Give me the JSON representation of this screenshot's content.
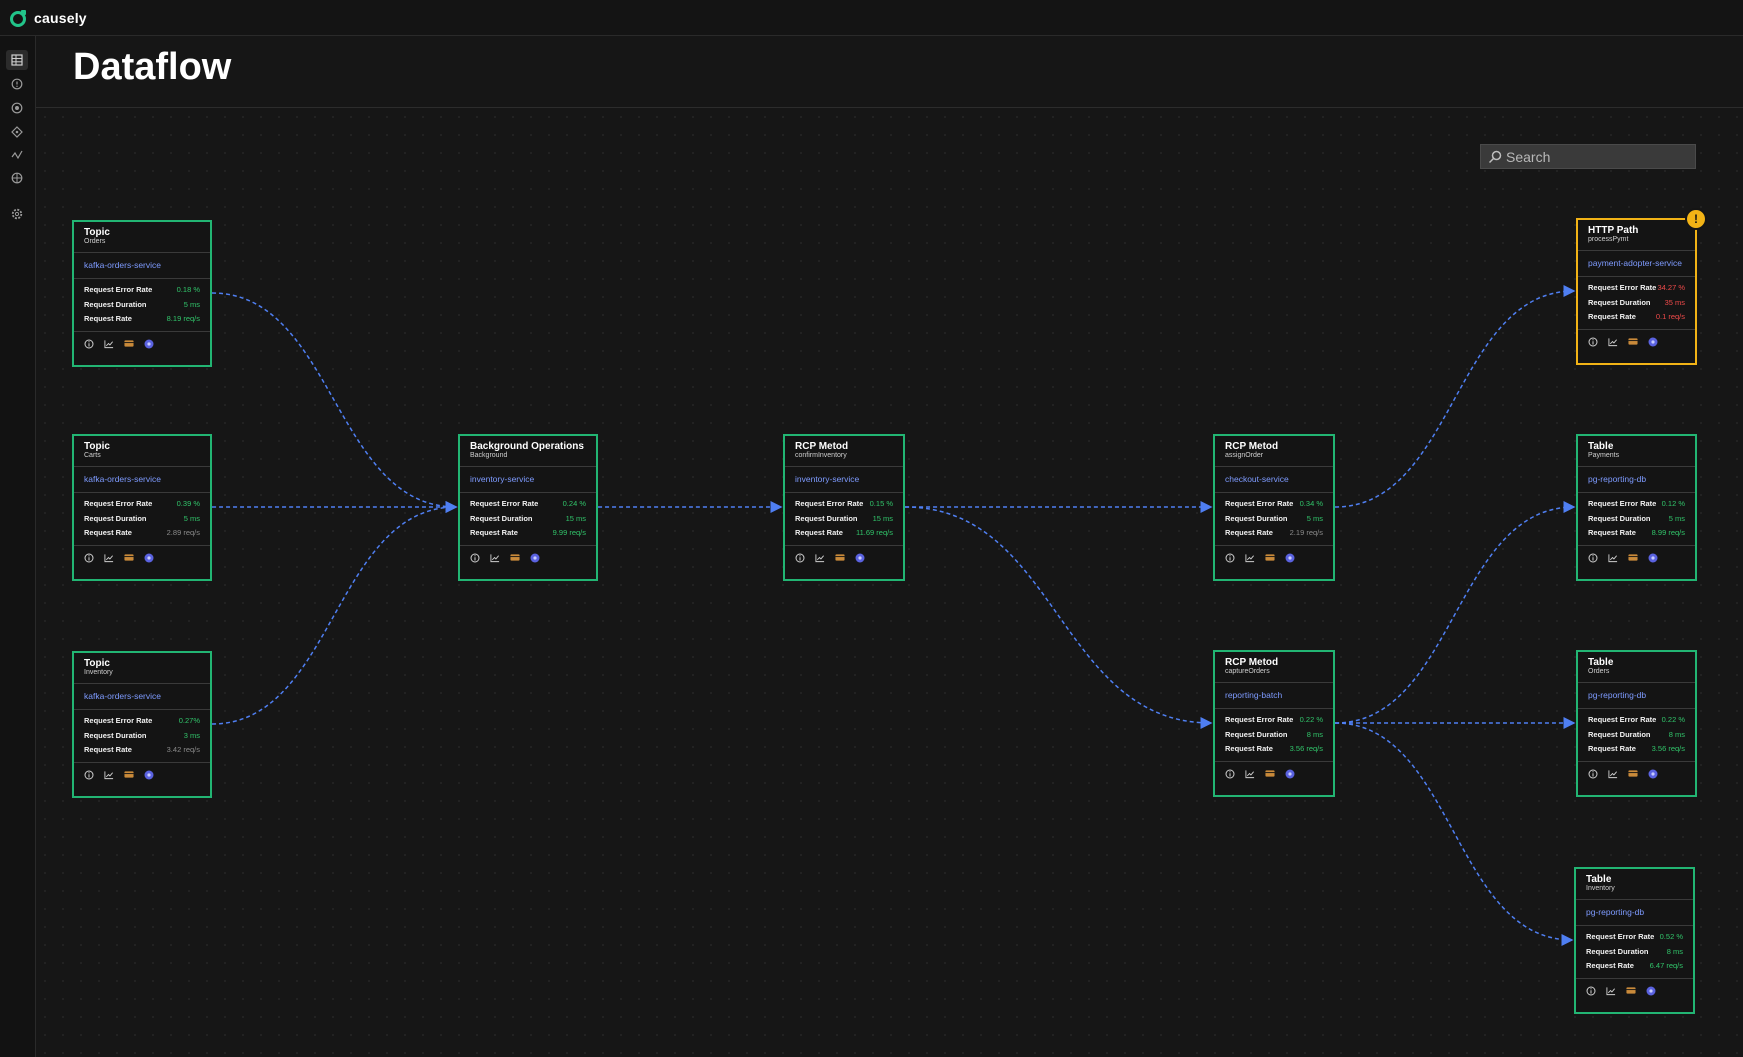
{
  "app": {
    "name": "causely"
  },
  "page": {
    "title": "Dataflow"
  },
  "sidebar": {
    "items": [
      {
        "icon": "table-icon",
        "active": true
      },
      {
        "icon": "alert-circle-icon"
      },
      {
        "icon": "target-icon"
      },
      {
        "icon": "diamond-icon"
      },
      {
        "icon": "activity-icon"
      },
      {
        "icon": "network-icon"
      },
      {
        "icon": "gear-icon"
      }
    ]
  },
  "search": {
    "placeholder": "Search"
  },
  "colors": {
    "healthy": "#22b573",
    "warning": "#f2b316",
    "service": "#7e9bff",
    "edge": "#4f7ff2",
    "good_value": "#31c46a",
    "bad_value": "#f04a4a"
  },
  "metric_labels": {
    "error_rate": "Request Error Rate",
    "duration": "Request Duration",
    "rate": "Request Rate"
  },
  "nodes": [
    {
      "id": "topic-orders",
      "type": "Topic",
      "sub": "Orders",
      "service": "kafka-orders-service",
      "error_rate": "0.18 %",
      "duration": "5 ms",
      "rate": "8.19 req/s",
      "status": "healthy"
    },
    {
      "id": "topic-carts",
      "type": "Topic",
      "sub": "Carts",
      "service": "kafka-orders-service",
      "error_rate": "0.39 %",
      "duration": "5 ms",
      "rate": "2.89 req/s",
      "status": "healthy"
    },
    {
      "id": "topic-inventory",
      "type": "Topic",
      "sub": "Inventory",
      "service": "kafka-orders-service",
      "error_rate": "0.27%",
      "duration": "3 ms",
      "rate": "3.42 req/s",
      "status": "healthy"
    },
    {
      "id": "background-ops",
      "type": "Background Operations",
      "sub": "Background",
      "service": "inventory-service",
      "error_rate": "0.24 %",
      "duration": "15 ms",
      "rate": "9.99 req/s",
      "status": "healthy"
    },
    {
      "id": "rcp-confirm",
      "type": "RCP Metod",
      "sub": "confirmInventory",
      "service": "inventory-service",
      "error_rate": "0.15 %",
      "duration": "15 ms",
      "rate": "11.69 req/s",
      "status": "healthy"
    },
    {
      "id": "rcp-assign",
      "type": "RCP Metod",
      "sub": "assignOrder",
      "service": "checkout-service",
      "error_rate": "0.34 %",
      "duration": "5 ms",
      "rate": "2.19 req/s",
      "status": "healthy"
    },
    {
      "id": "rcp-capture",
      "type": "RCP Metod",
      "sub": "captureOrders",
      "service": "reporting-batch",
      "error_rate": "0.22 %",
      "duration": "8 ms",
      "rate": "3.56 req/s",
      "status": "healthy"
    },
    {
      "id": "http-path",
      "type": "HTTP Path",
      "sub": "processPymt",
      "service": "payment-adopter-service",
      "error_rate": "34.27 %",
      "duration": "35 ms",
      "rate": "0.1 req/s",
      "status": "warning",
      "badge": "!"
    },
    {
      "id": "table-payments",
      "type": "Table",
      "sub": "Payments",
      "service": "pg-reporting-db",
      "error_rate": "0.12 %",
      "duration": "5 ms",
      "rate": "8.99 req/s",
      "status": "healthy"
    },
    {
      "id": "table-orders",
      "type": "Table",
      "sub": "Orders",
      "service": "pg-reporting-db",
      "error_rate": "0.22 %",
      "duration": "8 ms",
      "rate": "3.56 req/s",
      "status": "healthy"
    },
    {
      "id": "table-inventory",
      "type": "Table",
      "sub": "Inventory",
      "service": "pg-reporting-db",
      "error_rate": "0.52 %",
      "duration": "8 ms",
      "rate": "6.47 req/s",
      "status": "healthy"
    }
  ],
  "edges": [
    {
      "from": "topic-orders",
      "to": "background-ops"
    },
    {
      "from": "topic-carts",
      "to": "background-ops"
    },
    {
      "from": "topic-inventory",
      "to": "background-ops"
    },
    {
      "from": "background-ops",
      "to": "rcp-confirm"
    },
    {
      "from": "rcp-confirm",
      "to": "rcp-assign"
    },
    {
      "from": "rcp-confirm",
      "to": "rcp-capture"
    },
    {
      "from": "rcp-assign",
      "to": "http-path"
    },
    {
      "from": "rcp-capture",
      "to": "table-payments"
    },
    {
      "from": "rcp-capture",
      "to": "table-orders"
    },
    {
      "from": "rcp-capture",
      "to": "table-inventory"
    }
  ]
}
